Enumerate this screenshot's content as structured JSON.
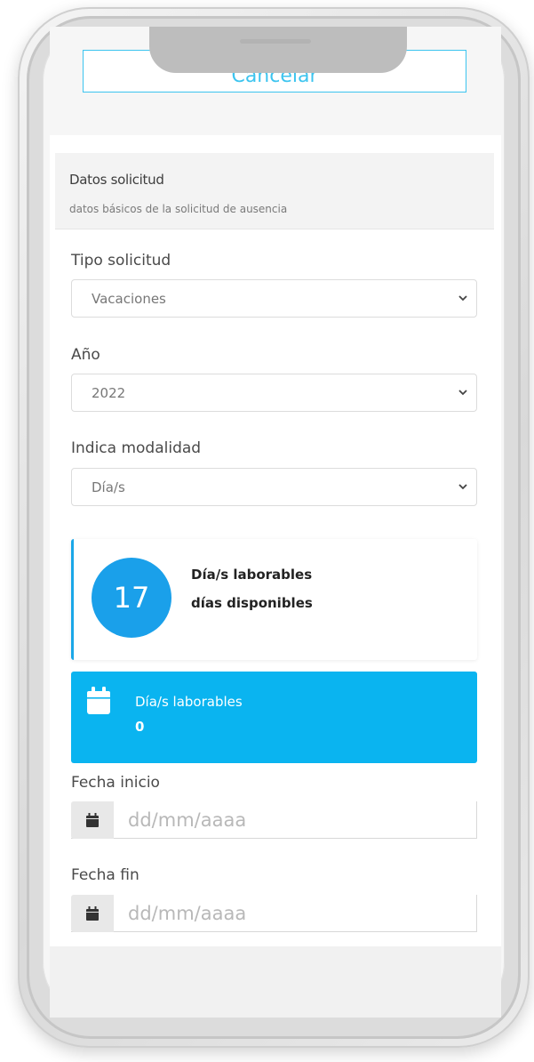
{
  "header": {
    "cancel_label": "Cancelar"
  },
  "section": {
    "title": "Datos solicitud",
    "subtitle": "datos básicos de la solicitud de ausencia"
  },
  "fields": {
    "tipo": {
      "label": "Tipo solicitud",
      "value": "Vacaciones"
    },
    "anio": {
      "label": "Año",
      "value": "2022"
    },
    "modalidad": {
      "label": "Indica modalidad",
      "value": "Día/s"
    }
  },
  "counter": {
    "value": "17",
    "line1": "Día/s laborables",
    "line2": "días disponibles"
  },
  "info": {
    "label": "Día/s laborables",
    "value": "0",
    "icon": "calendar-icon"
  },
  "dates": {
    "inicio": {
      "label": "Fecha inicio",
      "placeholder": "dd/mm/aaaa"
    },
    "fin": {
      "label": "Fecha fin",
      "placeholder": "dd/mm/aaaa"
    }
  },
  "colors": {
    "accent": "#0ab4f0",
    "circle": "#1aa0ea",
    "outline": "#3cc4ef"
  }
}
